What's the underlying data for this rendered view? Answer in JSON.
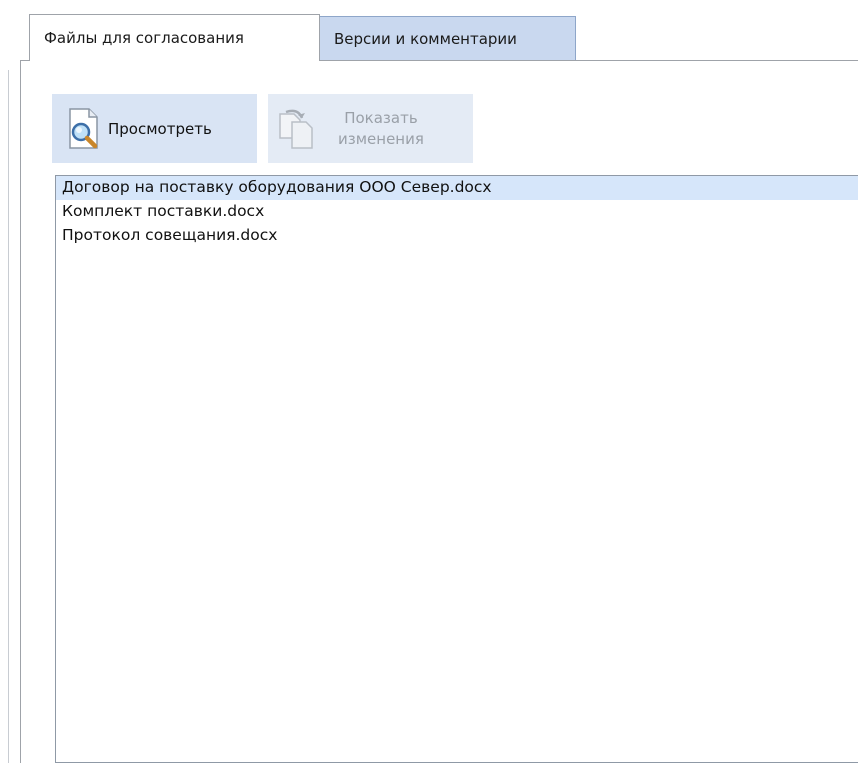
{
  "tabs": [
    {
      "label": "Файлы для согласования",
      "active": true
    },
    {
      "label": "Версии и комментарии",
      "active": false
    }
  ],
  "toolbar": {
    "view_label": "Просмотреть",
    "changes_label_line1": "Показать",
    "changes_label_line2": "изменения",
    "changes_enabled": false
  },
  "files": [
    {
      "name": "Договор на поставку оборудования ООО Север.docx",
      "selected": true
    },
    {
      "name": "Комплект поставки.docx",
      "selected": false
    },
    {
      "name": "Протокол совещания.docx",
      "selected": false
    }
  ],
  "colors": {
    "selection": "#d6e6fa",
    "button_bg": "#d9e4f4",
    "inactive_tab": "#c9d8ef"
  }
}
